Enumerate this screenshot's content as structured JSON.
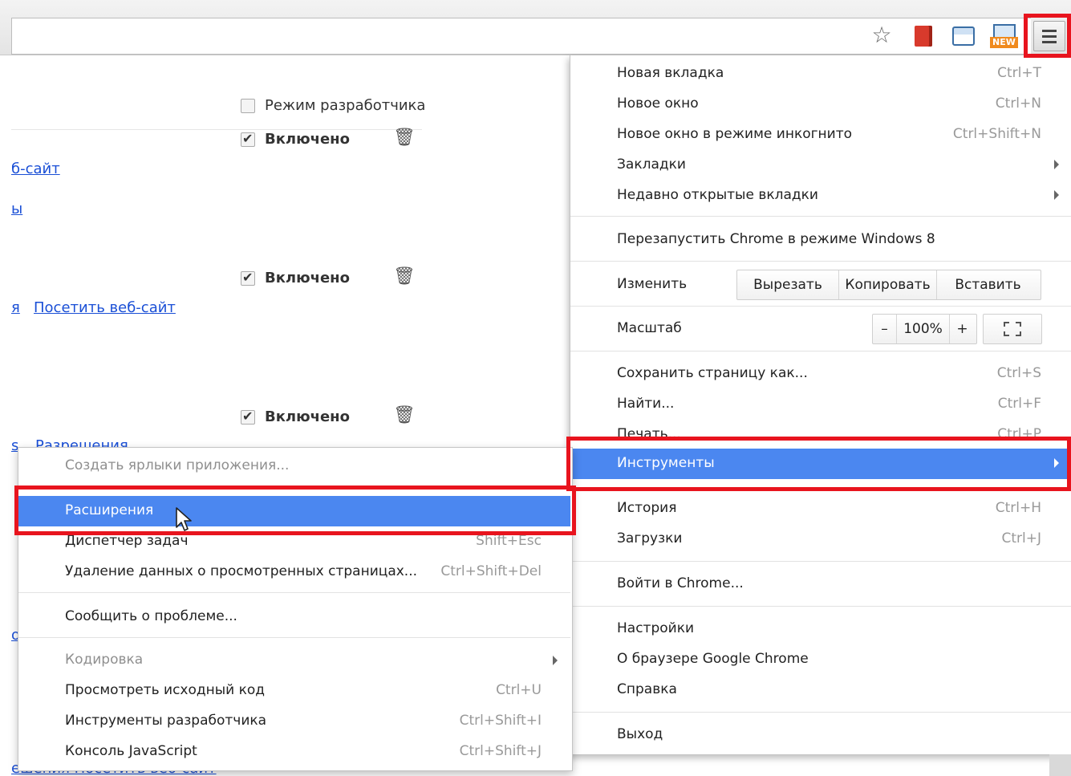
{
  "colors": {
    "accent": "#4b87f0",
    "annotation_red": "#e8141e",
    "link": "#1a4fd6"
  },
  "toolbar": {
    "star_icon": "star-outline-icon",
    "new_badge": "NEW",
    "menu_icon": "hamburger-menu-icon"
  },
  "page": {
    "developer_mode_label": "Режим разработчика",
    "extensions": [
      {
        "enabled_label": "Включено"
      },
      {
        "enabled_label": "Включено"
      },
      {
        "enabled_label": "Включено"
      }
    ],
    "links": {
      "visit_site_1": "б-сайт",
      "frag_1": "ы",
      "perm_frag": "я",
      "visit_site_2": "Посетить веб-сайт",
      "perm_3": "Разрешения",
      "frag_s": "s",
      "frag_o": "о",
      "bottom": "ешения   Посетить веб-сайт"
    }
  },
  "main_menu": {
    "new_tab": {
      "label": "Новая вкладка",
      "shortcut": "Ctrl+T"
    },
    "new_window": {
      "label": "Новое окно",
      "shortcut": "Ctrl+N"
    },
    "incognito": {
      "label": "Новое окно в режиме инкогнито",
      "shortcut": "Ctrl+Shift+N"
    },
    "bookmarks": {
      "label": "Закладки"
    },
    "recent_tabs": {
      "label": "Недавно открытые вкладки"
    },
    "relaunch_win8": {
      "label": "Перезапустить Chrome в режиме Windows 8"
    },
    "edit": {
      "label": "Изменить",
      "cut": "Вырезать",
      "copy": "Копировать",
      "paste": "Вставить"
    },
    "zoom": {
      "label": "Масштаб",
      "minus": "–",
      "value": "100%",
      "plus": "+"
    },
    "save_page": {
      "label": "Сохранить страницу как...",
      "shortcut": "Ctrl+S"
    },
    "find": {
      "label": "Найти...",
      "shortcut": "Ctrl+F"
    },
    "print": {
      "label": "Печать...",
      "shortcut": "Ctrl+P"
    },
    "tools": {
      "label": "Инструменты"
    },
    "history": {
      "label": "История",
      "shortcut": "Ctrl+H"
    },
    "downloads": {
      "label": "Загрузки",
      "shortcut": "Ctrl+J"
    },
    "sign_in": {
      "label": "Войти в Chrome..."
    },
    "settings": {
      "label": "Настройки"
    },
    "about": {
      "label": "О браузере Google Chrome"
    },
    "help": {
      "label": "Справка"
    },
    "exit": {
      "label": "Выход"
    }
  },
  "tools_submenu": {
    "create_shortcuts": {
      "label": "Создать ярлыки приложения..."
    },
    "extensions": {
      "label": "Расширения"
    },
    "task_manager": {
      "label": "Диспетчер задач",
      "shortcut": "Shift+Esc"
    },
    "clear_data": {
      "label": "Удаление данных о просмотренных страницах...",
      "shortcut": "Ctrl+Shift+Del"
    },
    "report_issue": {
      "label": "Сообщить о проблеме..."
    },
    "encoding": {
      "label": "Кодировка"
    },
    "view_source": {
      "label": "Просмотреть исходный код",
      "shortcut": "Ctrl+U"
    },
    "dev_tools": {
      "label": "Инструменты разработчика",
      "shortcut": "Ctrl+Shift+I"
    },
    "js_console": {
      "label": "Консоль JavaScript",
      "shortcut": "Ctrl+Shift+J"
    }
  }
}
